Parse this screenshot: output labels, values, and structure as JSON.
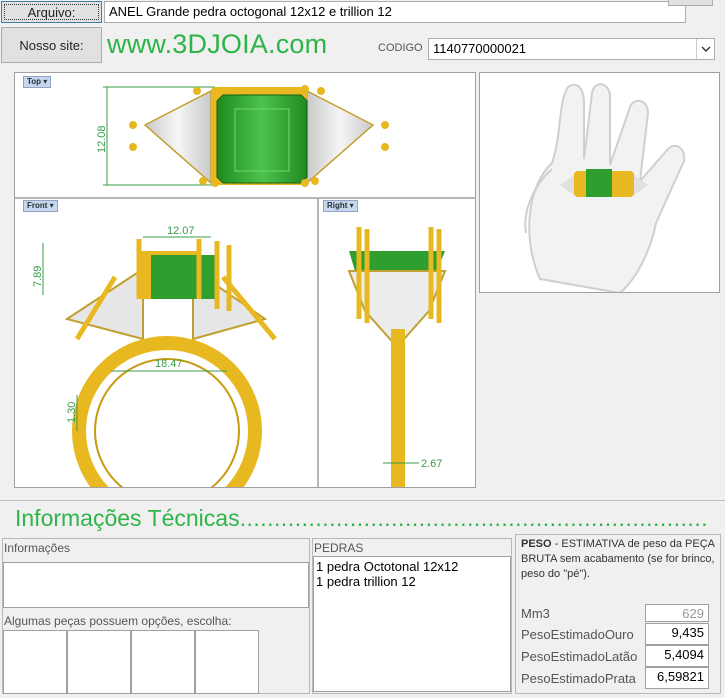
{
  "header": {
    "arquivo_button": "Arquivo:",
    "arquivo_value": "ANEL Grande pedra octogonal 12x12 e trillion 12",
    "site_button": "Nosso site:",
    "site_url": "www.3DJOIA.com",
    "codigo_label": "CODIGO",
    "codigo_value": "1140770000021"
  },
  "views": {
    "top_tag": "Top",
    "front_tag": "Front",
    "right_tag": "Right",
    "dims": {
      "top_height": "12.08",
      "front_width": "12.07",
      "front_height": "7.89",
      "front_inner": "18.47",
      "front_band": "1.30",
      "right_band": "2.67"
    }
  },
  "tech": {
    "title": "Informações Técnicas",
    "informacoes_label": "Informações",
    "opcoes_label": "Algumas peças possuem opções, escolha:",
    "pedras_label": "PEDRAS",
    "pedras": [
      "1 pedra Octotonal 12x12",
      "1 pedra trillion 12"
    ],
    "peso_label": "PESO",
    "peso_desc": " - ESTIMATIVA de peso da PEÇA BRUTA sem acabamento (se for brinco, peso do \"pé\").",
    "mm3_label": "Mm3",
    "mm3_value": "629",
    "ouro_label": "PesoEstimadoOuro",
    "ouro_value": "9,435",
    "latao_label": "PesoEstimadoLatão",
    "latao_value": "5,4094",
    "prata_label": "PesoEstimadoPrata",
    "prata_value": "6,59821"
  },
  "colors": {
    "brand_green": "#2fb449",
    "gold": "#e8b820",
    "emerald": "#2e9e2e"
  }
}
